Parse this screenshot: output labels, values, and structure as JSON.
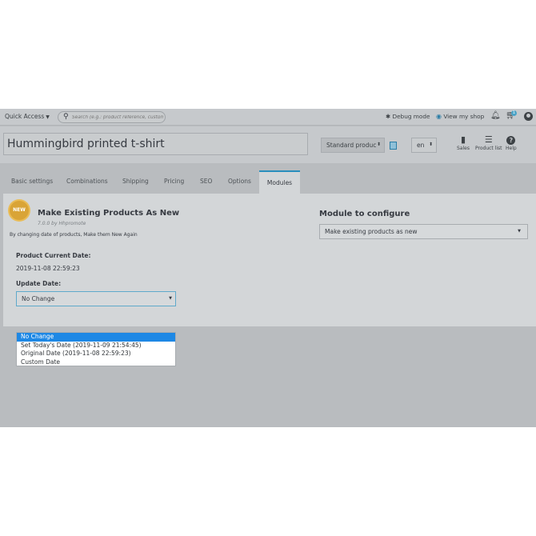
{
  "topbar": {
    "quick_access": "Quick Access",
    "search_placeholder": "Search (e.g.: product reference, custome",
    "debug_mode": "Debug mode",
    "view_shop": "View my shop",
    "cart_count": "1"
  },
  "header": {
    "product_name": "Hummingbird printed t-shirt",
    "product_type": "Standard produc",
    "language": "en",
    "buttons": [
      {
        "label": "Sales",
        "icon": "bar-chart-icon"
      },
      {
        "label": "Product list",
        "icon": "list-icon"
      },
      {
        "label": "Help",
        "icon": "help-icon"
      }
    ]
  },
  "tabs": [
    {
      "label": "Basic settings"
    },
    {
      "label": "Combinations"
    },
    {
      "label": "Shipping"
    },
    {
      "label": "Pricing"
    },
    {
      "label": "SEO"
    },
    {
      "label": "Options"
    },
    {
      "label": "Modules",
      "active": true
    }
  ],
  "module": {
    "badge": "NEW",
    "title": "Make Existing Products As New",
    "version": "7.0.0 by Hhpromote",
    "description": "By changing date of products, Make them New Again",
    "current_date_label": "Product Current Date:",
    "current_date_value": "2019-11-08 22:59:23",
    "update_date_label": "Update Date:",
    "update_date_selected": "No Change"
  },
  "configure": {
    "title": "Module to configure",
    "selected": "Make existing products as new"
  },
  "dropdown_options": [
    {
      "label": "No Change",
      "selected": true
    },
    {
      "label": "Set Today's Date (2019-11-09 21:54:45)"
    },
    {
      "label": "Original Date (2019-11-08 22:59:23)"
    },
    {
      "label": "Custom Date"
    }
  ],
  "colors": {
    "accent": "#2a8fbd",
    "selected_option": "#1e88e5",
    "badge": "#d9a437"
  }
}
